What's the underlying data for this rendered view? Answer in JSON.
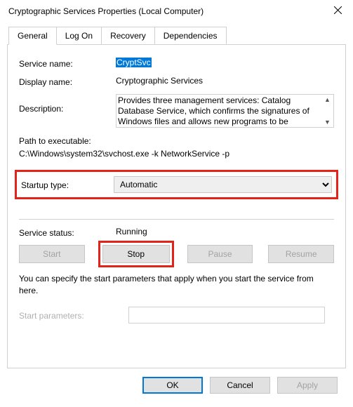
{
  "window": {
    "title": "Cryptographic Services Properties (Local Computer)"
  },
  "tabs": {
    "general": "General",
    "log_on": "Log On",
    "recovery": "Recovery",
    "dependencies": "Dependencies"
  },
  "general": {
    "labels": {
      "service_name": "Service name:",
      "display_name": "Display name:",
      "description": "Description:",
      "path_label": "Path to executable:",
      "startup_type": "Startup type:",
      "service_status": "Service status:",
      "start_parameters": "Start parameters:"
    },
    "service_name_value": "CryptSvc",
    "display_name_value": "Cryptographic Services",
    "description_value": "Provides three management services: Catalog Database Service, which confirms the signatures of Windows files and allows new programs to be",
    "path_value": "C:\\Windows\\system32\\svchost.exe -k NetworkService -p",
    "startup_type_value": "Automatic",
    "service_status_value": "Running",
    "buttons": {
      "start": "Start",
      "stop": "Stop",
      "pause": "Pause",
      "resume": "Resume"
    },
    "note": "You can specify the start parameters that apply when you start the service from here.",
    "start_parameters_value": ""
  },
  "dialog_buttons": {
    "ok": "OK",
    "cancel": "Cancel",
    "apply": "Apply"
  }
}
